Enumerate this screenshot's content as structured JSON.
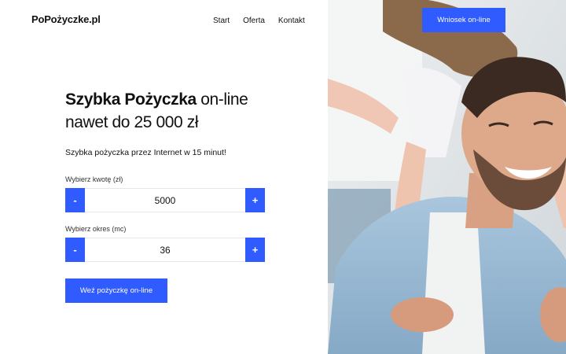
{
  "header": {
    "logo": "PoPożyczke.pl",
    "nav": [
      {
        "label": "Start"
      },
      {
        "label": "Oferta"
      },
      {
        "label": "Kontakt"
      }
    ],
    "apply_button": "Wniosek on-line"
  },
  "hero": {
    "title_bold": "Szybka Pożyczka",
    "title_light": " on-line",
    "title_line2": "nawet do 25 000 zł",
    "subtitle": "Szybka pożyczka przez Internet w 15 minut!"
  },
  "form": {
    "amount": {
      "label": "Wybierz kwotę (zł)",
      "value": "5000",
      "minus": "-",
      "plus": "+"
    },
    "term": {
      "label": "Wybierz okres (mc)",
      "value": "36",
      "minus": "-",
      "plus": "+"
    },
    "submit": "Weź pożyczkę on-line"
  },
  "colors": {
    "accent": "#2f5bff"
  },
  "image": {
    "description_icon": "family-photo"
  }
}
